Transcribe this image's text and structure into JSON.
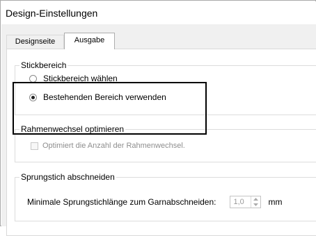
{
  "window": {
    "title": "Design-Einstellungen"
  },
  "tabs": [
    {
      "label": "Designseite",
      "active": false
    },
    {
      "label": "Ausgabe",
      "active": true
    }
  ],
  "stickbereich": {
    "label": "Stickbereich",
    "options": [
      {
        "label": "Stickbereich wählen",
        "checked": false
      },
      {
        "label": "Bestehenden Bereich verwenden",
        "checked": true
      }
    ]
  },
  "rahmenwechsel": {
    "label": "Rahmenwechsel optimieren",
    "checkbox_label": "Optimiert die Anzahl der Rahmenwechsel.",
    "checked": false,
    "enabled": false
  },
  "sprungstich": {
    "label": "Sprungstich abschneiden",
    "field_label": "Minimale Sprungstichlänge zum Garnabschneiden:",
    "value": "1,0",
    "unit": "mm"
  }
}
